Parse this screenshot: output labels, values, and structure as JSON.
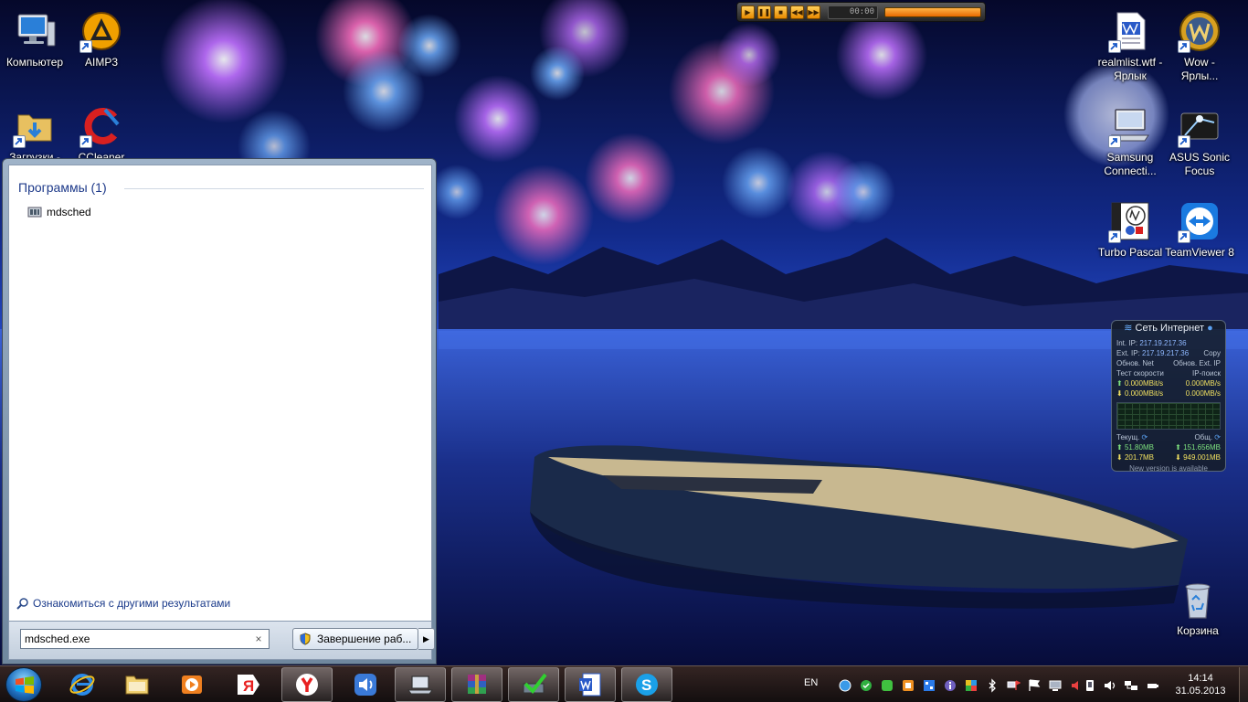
{
  "desktop": {
    "icons": [
      {
        "id": "computer",
        "label": "Компьютер",
        "icon": "computer-icon",
        "shortcut": false
      },
      {
        "id": "aimp3",
        "label": "AIMP3",
        "icon": "aimp-icon",
        "shortcut": true
      },
      {
        "id": "downloads",
        "label": "Загрузки -",
        "icon": "downloads-folder-icon",
        "shortcut": true
      },
      {
        "id": "ccleaner",
        "label": "CCleaner",
        "icon": "ccleaner-icon",
        "shortcut": true
      },
      {
        "id": "realmlist",
        "label": "realmlist.wtf - Ярлык",
        "icon": "text-document-icon",
        "shortcut": true
      },
      {
        "id": "wow",
        "label": "Wow - Ярлы...",
        "icon": "wow-icon",
        "shortcut": true
      },
      {
        "id": "samsung",
        "label": "Samsung Connecti...",
        "icon": "monitor-icon",
        "shortcut": true
      },
      {
        "id": "asus",
        "label": "ASUS Sonic Focus",
        "icon": "asus-sonic-focus-icon",
        "shortcut": true
      },
      {
        "id": "turbopascal",
        "label": "Turbo Pascal",
        "icon": "turbo-pascal-icon",
        "shortcut": true
      },
      {
        "id": "teamviewer",
        "label": "TeamViewer 8",
        "icon": "teamviewer-icon",
        "shortcut": true
      },
      {
        "id": "recycle",
        "label": "Корзина",
        "icon": "recycle-bin-icon",
        "shortcut": false
      }
    ]
  },
  "aimp_player": {
    "time": "00:00",
    "progress": 1.0
  },
  "start_search": {
    "group_title": "Программы (1)",
    "result_item": "mdsched",
    "more_results": "Ознакомиться с другими результатами",
    "search_value": "mdsched.exe",
    "clear_symbol": "×",
    "shutdown_label": "Завершение раб...",
    "shutdown_arrow": "▶"
  },
  "net_gadget": {
    "title": "Сеть Интернет",
    "int_ip_label": "Int. IP:",
    "int_ip": "217.19.217.36",
    "ext_ip_label": "Ext. IP:",
    "ext_ip": "217.19.217.36",
    "copy": "Copy",
    "update_net": "Обнов. Net",
    "update_ext": "Обнов. Ext. IP",
    "speed_test": "Тест скорости",
    "ip_search": "IP-поиск",
    "up_speed_bits": "0.000MBit/s",
    "up_speed_bytes": "0.000MB/s",
    "down_speed_bits": "0.000MBit/s",
    "down_speed_bytes": "0.000MB/s",
    "current_label": "Текущ.",
    "total_label": "Общ.",
    "current_up": "51.80MB",
    "current_down": "201.7MB",
    "total_up": "151.656MB",
    "total_down": "949.001MB",
    "footer": "New version is available"
  },
  "taskbar": {
    "language": "EN",
    "time": "14:14",
    "date": "31.05.2013",
    "pinned": [
      {
        "name": "internet-explorer",
        "icon": "ie-icon",
        "active": false
      },
      {
        "name": "explorer",
        "icon": "folder-icon",
        "active": false
      },
      {
        "name": "media-player",
        "icon": "media-player-icon",
        "active": false
      },
      {
        "name": "yandex",
        "icon": "yandex-icon",
        "active": false
      },
      {
        "name": "yandex-browser",
        "icon": "yandex-browser-icon",
        "active": true
      },
      {
        "name": "volume-app",
        "icon": "speaker-app-icon",
        "active": false
      },
      {
        "name": "computer-window",
        "icon": "laptop-icon",
        "active": true
      },
      {
        "name": "winrar",
        "icon": "winrar-icon",
        "active": true
      },
      {
        "name": "diagnostic-tool",
        "icon": "checkmark-tool-icon",
        "active": true
      },
      {
        "name": "word",
        "icon": "word-icon",
        "active": true
      },
      {
        "name": "skype",
        "icon": "skype-icon",
        "active": true
      }
    ]
  },
  "colors": {
    "accent": "#1e3a8a",
    "taskbar": "#2a1c16",
    "player_orange": "#e88a00"
  }
}
